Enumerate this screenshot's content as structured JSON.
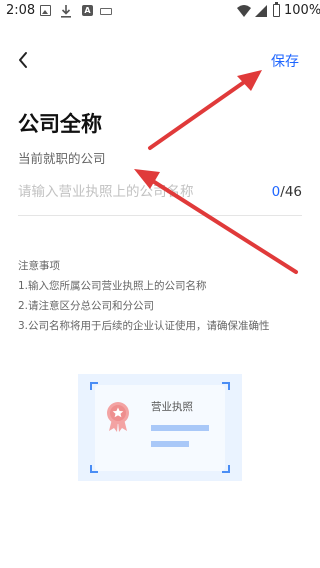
{
  "status_bar": {
    "time": "2:08",
    "battery": "100%",
    "icons": [
      "image-icon",
      "download-icon",
      "a-icon",
      "keyboard-icon",
      "wifi-icon",
      "signal-icon",
      "battery-icon"
    ]
  },
  "header": {
    "back_icon": "chevron-left-icon",
    "save_label": "保存"
  },
  "form": {
    "title": "公司全称",
    "field_label": "当前就职的公司",
    "input_value": "",
    "input_placeholder": "请输入营业执照上的公司名称",
    "count_current": "0",
    "count_max": "/46"
  },
  "notes": {
    "heading": "注意事项",
    "items": [
      "1.输入您所属公司营业执照上的公司名称",
      "2.请注意区分总公司和分公司",
      "3.公司名称将用于后续的企业认证使用，请确保准确性"
    ]
  },
  "illustration": {
    "license_label": "营业执照"
  },
  "colors": {
    "accent": "#1f66ff",
    "annotation_arrow": "#e03a3a",
    "illustration_bg": "#eaf3ff"
  }
}
